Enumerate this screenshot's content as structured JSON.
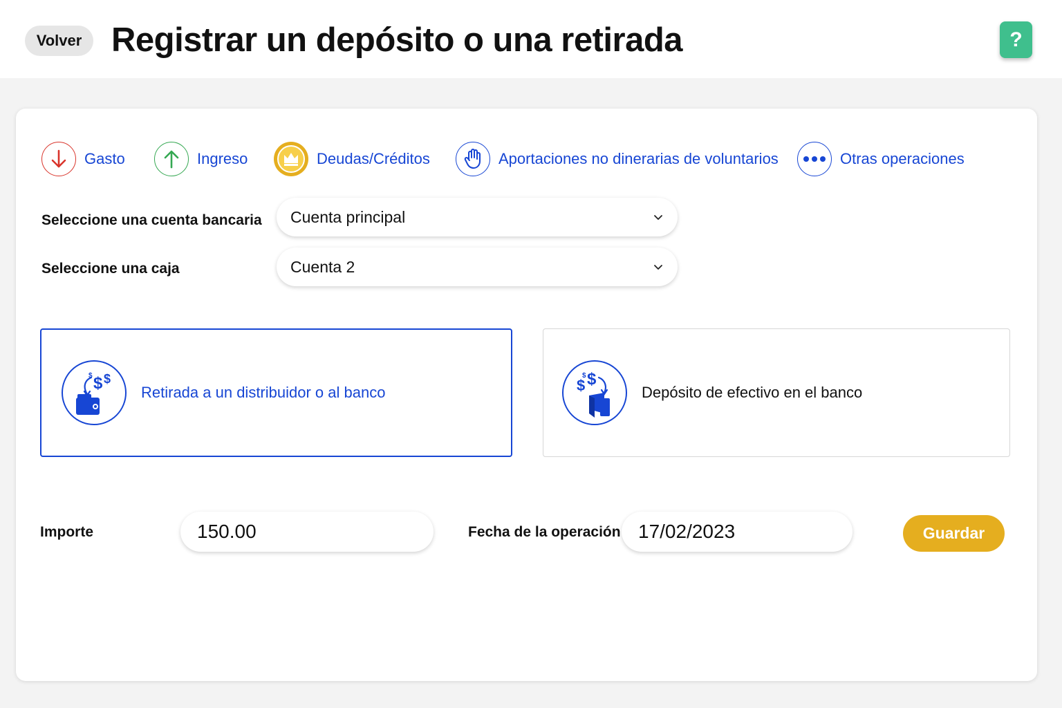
{
  "header": {
    "back_label": "Volver",
    "title": "Registrar un depósito o una retirada",
    "help_label": "?"
  },
  "operation_types": [
    {
      "label": "Gasto",
      "icon": "arrow-down-icon",
      "color": "#d9342b"
    },
    {
      "label": "Ingreso",
      "icon": "arrow-up-icon",
      "color": "#35a852"
    },
    {
      "label": "Deudas/Créditos",
      "icon": "crown-coin-icon",
      "color": "#e5ae1f"
    },
    {
      "label": "Aportaciones no dinerarias de voluntarios",
      "icon": "raised-hand-icon",
      "color": "#1746d4"
    },
    {
      "label": "Otras operaciones",
      "icon": "more-dots-icon",
      "color": "#1746d4"
    }
  ],
  "form": {
    "bank_account_label": "Seleccione una cuenta bancaria",
    "bank_account_value": "Cuenta principal",
    "cash_box_label": "Seleccione una caja",
    "cash_box_value": "Cuenta 2",
    "amount_label": "Importe",
    "amount_value": "150.00",
    "date_label": "Fecha de la operación",
    "date_value": "17/02/2023",
    "save_label": "Guardar"
  },
  "operations": [
    {
      "label": "Retirada a un distribuidor o al banco",
      "icon": "cash-withdrawal-icon",
      "selected": true
    },
    {
      "label": "Depósito de efectivo en el banco",
      "icon": "cash-deposit-icon",
      "selected": false
    }
  ],
  "colors": {
    "accent_blue": "#1746d4",
    "help_green": "#3fbf8d",
    "save_yellow": "#e5ae1f"
  }
}
